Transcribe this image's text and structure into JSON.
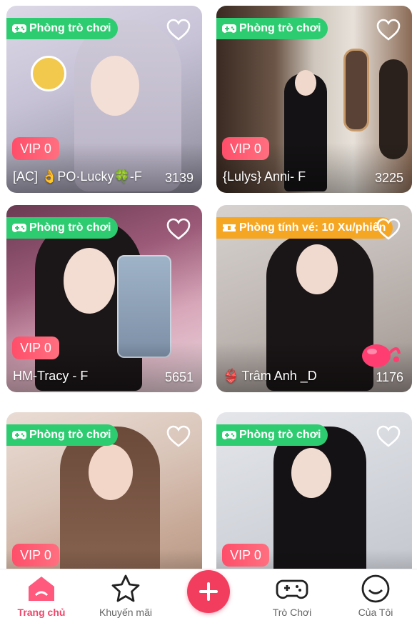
{
  "colors": {
    "accent": "#f23d5e",
    "badge_green": "#2ecc71",
    "badge_orange": "#f5a623",
    "vip": "#ff4e6a"
  },
  "cards": [
    {
      "badge": "Phòng trò chơi",
      "badge_icon": "gamepad-icon",
      "vip": "VIP 0",
      "name": "[AC] 👌PO·Lucky🍀-F",
      "count": "3139"
    },
    {
      "badge": "Phòng trò chơi",
      "badge_icon": "gamepad-icon",
      "vip": "VIP 0",
      "name": "{Lulys} Anni- F",
      "count": "3225"
    },
    {
      "badge": "Phòng trò chơi",
      "badge_icon": "gamepad-icon",
      "vip": "VIP 0",
      "name": "HM-Tracy - F",
      "count": "5651"
    },
    {
      "badge": "Phòng tính vé: 10 Xu/phiên",
      "badge_icon": "ticket-icon",
      "vip": "",
      "name": "Trâm Anh _D",
      "count": "1176"
    },
    {
      "badge": "Phòng trò chơi",
      "badge_icon": "gamepad-icon",
      "vip": "VIP 0",
      "name": "",
      "count": ""
    },
    {
      "badge": "Phòng trò chơi",
      "badge_icon": "gamepad-icon",
      "vip": "VIP 0",
      "name": "",
      "count": ""
    }
  ],
  "nav": {
    "home": "Trang chủ",
    "promo": "Khuyến mãi",
    "games": "Trò Chơi",
    "me": "Của Tôi"
  }
}
